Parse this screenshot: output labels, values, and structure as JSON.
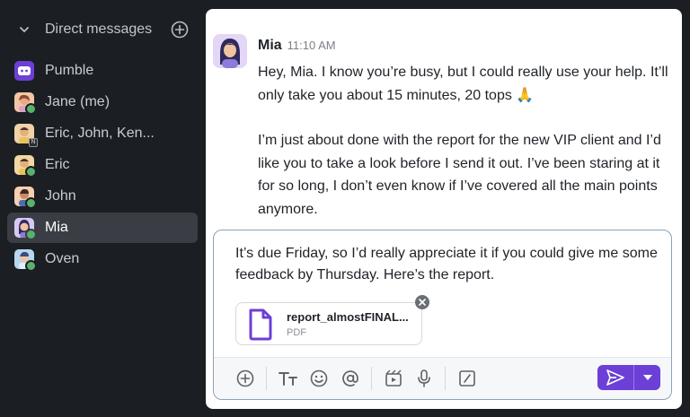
{
  "sidebar": {
    "section_title": "Direct messages",
    "items": [
      {
        "label": "Pumble",
        "avatar_color": "#6c3fd6",
        "status": "bot"
      },
      {
        "label": "Jane (me)",
        "avatar_color": "#f2c6a6",
        "status": "online"
      },
      {
        "label": "Eric, John, Ken...",
        "avatar_color": "#f1d2a8",
        "status": "group",
        "group_count": "N"
      },
      {
        "label": "Eric",
        "avatar_color": "#f3d7a3",
        "status": "online"
      },
      {
        "label": "John",
        "avatar_color": "#f6cfb0",
        "status": "online"
      },
      {
        "label": "Mia",
        "avatar_color": "#d9c8f5",
        "status": "online",
        "active": true
      },
      {
        "label": "Oven",
        "avatar_color": "#b8d6f0",
        "status": "online"
      }
    ]
  },
  "message": {
    "author": "Mia",
    "time": "11:10 AM",
    "paragraphs": [
      "Hey, Mia. I know you’re busy, but I could really use your help. It’ll only take you about 15 minutes, 20 tops 🙏",
      "I’m just about done with the report for the new VIP client and I’d like you to take a look before I send it out. I’ve been staring at it for so long, I don’t even know if I’ve covered all  the main points anymore."
    ]
  },
  "composer": {
    "draft": "It’s due Friday, so I’d really appreciate it if you could give me some feedback by Thursday. Here’s the report.",
    "attachment": {
      "name": "report_almostFINAL...",
      "type": "PDF"
    }
  },
  "colors": {
    "accent": "#6c3fd6",
    "online": "#59b26a",
    "sidebar_bg": "#1b1e22"
  }
}
